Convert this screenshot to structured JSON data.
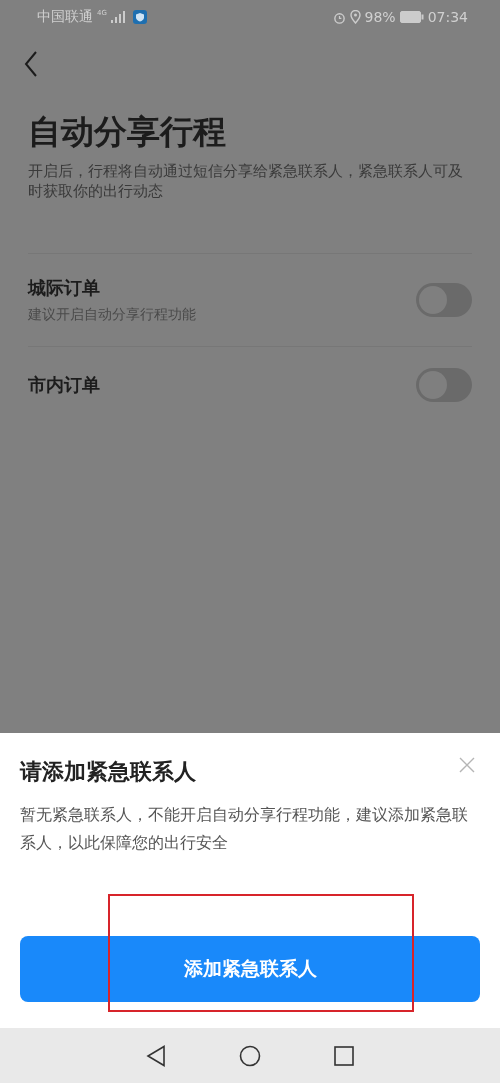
{
  "status_bar": {
    "carrier": "中国联通",
    "network": "4G",
    "battery": "98%",
    "time": "07:34"
  },
  "page": {
    "title": "自动分享行程",
    "description": "开启后，行程将自动通过短信分享给紧急联系人，紧急联系人可及时获取你的出行动态"
  },
  "settings": [
    {
      "label": "城际订单",
      "hint": "建议开启自动分享行程功能",
      "on": false
    },
    {
      "label": "市内订单",
      "on": false
    }
  ],
  "dialog": {
    "title": "请添加紧急联系人",
    "message": "暂无紧急联系人，不能开启自动分享行程功能，建议添加紧急联系人，以此保障您的出行安全",
    "button": "添加紧急联系人"
  }
}
